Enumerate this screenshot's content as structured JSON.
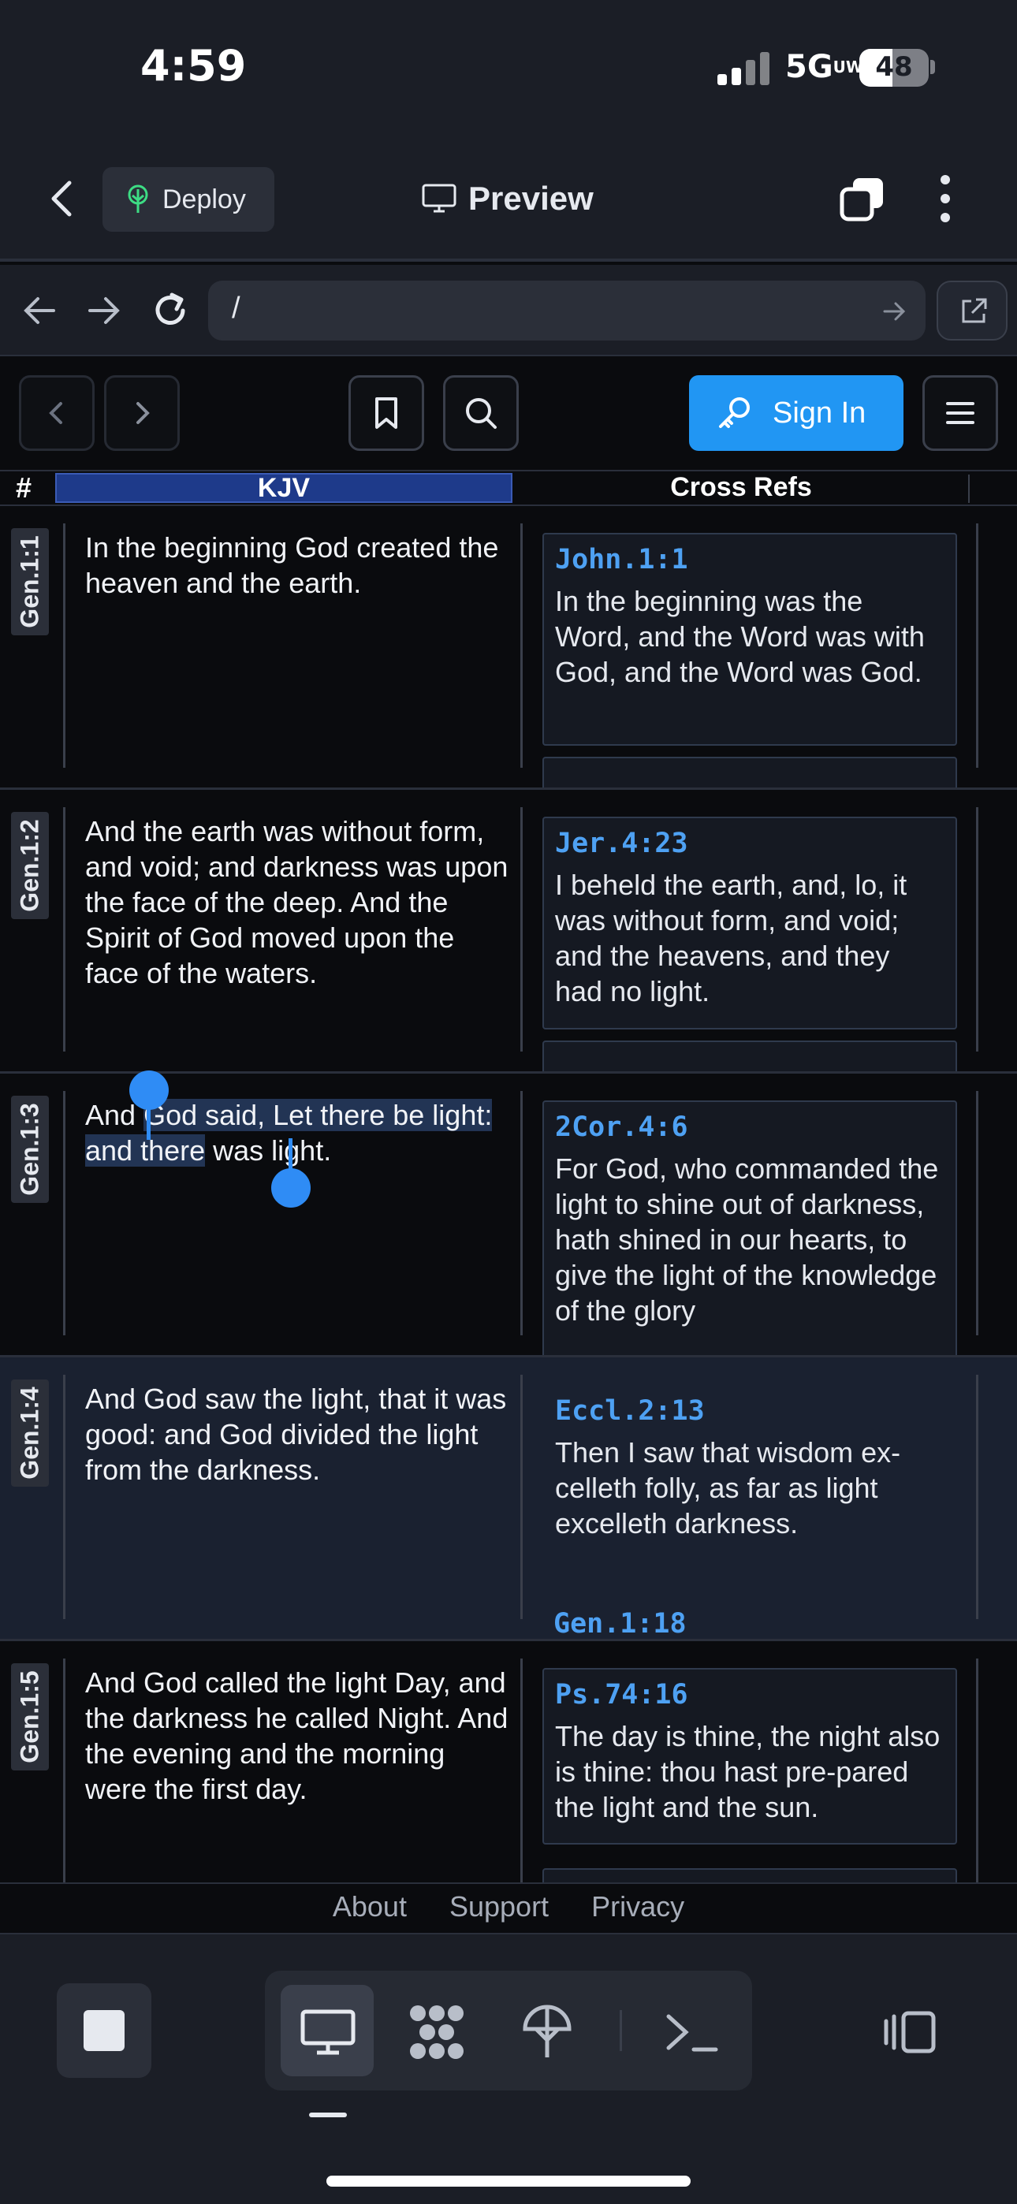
{
  "status_bar": {
    "time": "4:59",
    "network": "5G",
    "network_sub": "UW",
    "battery": "48",
    "battery_level": 0.48
  },
  "app_header": {
    "deploy_label": "Deploy",
    "preview_label": "Preview"
  },
  "url_bar": {
    "url": "/"
  },
  "toolbar": {
    "sign_in_label": "Sign In"
  },
  "table": {
    "hash_header": "#",
    "kjv_header": "KJV",
    "cross_header": "Cross Refs",
    "rows": [
      {
        "ref": "Gen.1:1",
        "verse": "In the beginning God created the heaven and the earth.",
        "cross": {
          "ref": "John.1:1",
          "text": "In the beginning was the Word, and the Word was with God, and the Word was God."
        }
      },
      {
        "ref": "Gen.1:2",
        "verse": "And the earth was without form, and void; and darkness was upon the face of the deep. And the Spirit of God moved upon the face of the waters.",
        "cross": {
          "ref": "Jer.4:23",
          "text": "I beheld the earth, and, lo, it was without form, and void; and the heavens, and they had no light."
        }
      },
      {
        "ref": "Gen.1:3",
        "verse_before": "And ",
        "verse_selected": "God said, Let there be light: and there",
        "verse_after": " was light.",
        "cross": {
          "ref": "2Cor.4:6",
          "text": "For God, who commanded the light to shine out of darkness, hath shined in our hearts, to give the light of the knowledge of the glory"
        }
      },
      {
        "ref": "Gen.1:4",
        "verse": "And God saw the light, that it was good: and God divided the light from the darkness.",
        "cross": {
          "ref": "Eccl.2:13",
          "text": "Then I saw that wisdom ex-celleth folly, as far as light excelleth darkness."
        },
        "next_ref": "Gen.1:18"
      },
      {
        "ref": "Gen.1:5",
        "verse": "And God called the light Day, and the darkness he called Night. And the evening and the morning were the first day.",
        "cross": {
          "ref": "Ps.74:16",
          "text": "The day is thine, the night also is thine: thou hast pre-pared the light and the sun."
        }
      }
    ]
  },
  "footer": {
    "about": "About",
    "support": "Support",
    "privacy": "Privacy"
  },
  "colors": {
    "accent": "#2196f3",
    "link": "#4ea1f3",
    "kjv_header": "#1e3a8a"
  }
}
